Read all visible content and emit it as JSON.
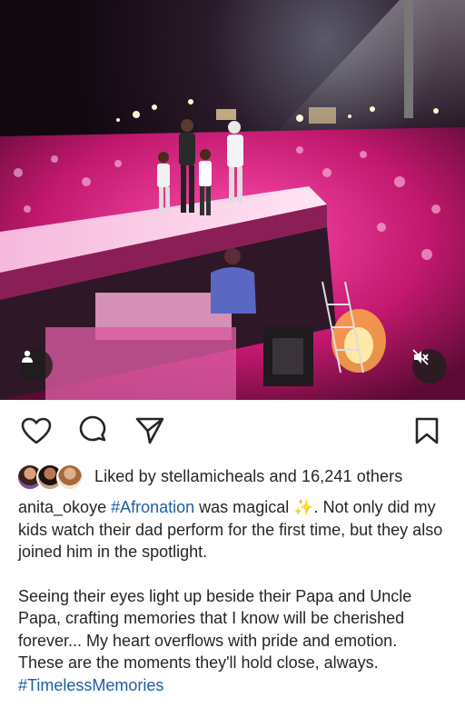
{
  "post": {
    "media_type": "video",
    "media_description": "Concert stage under pink lights with performers walking on stage and a large crowd",
    "muted": true
  },
  "icons": {
    "like": "heart-icon",
    "comment": "comment-bubble-icon",
    "share": "paper-plane-icon",
    "save": "bookmark-icon",
    "tag": "user-tag-icon",
    "mute": "speaker-muted-icon"
  },
  "likes": {
    "prefix": "Liked by ",
    "user": "stellamicheals",
    "middle": " and ",
    "count": "16,241",
    "suffix": " others"
  },
  "caption": {
    "username": "anita_okoye",
    "hashtag1": "#Afronation",
    "text1": " was magical ✨. Not only did my kids watch their dad perform for the first time, but they also joined him in the spotlight.",
    "text2": "Seeing their eyes light up beside their Papa and Uncle Papa, crafting memories that I know will be cherished forever... My heart overflows with pride and emotion. These are the moments they'll hold close, always. ",
    "hashtag2": "#TimelessMemories"
  },
  "colors": {
    "link": "#1b5fa5",
    "text": "#262626",
    "stage_light": "#e0379a"
  }
}
